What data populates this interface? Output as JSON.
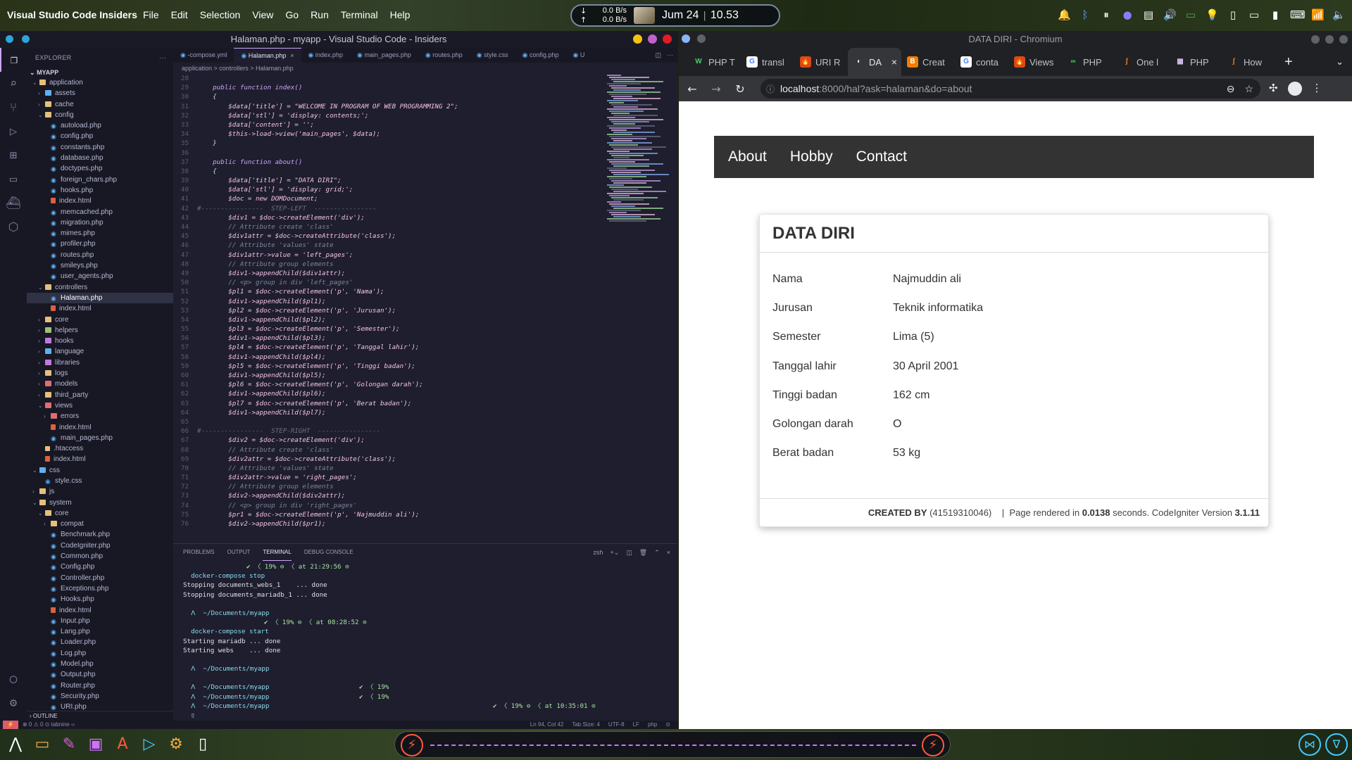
{
  "topbar": {
    "app_name": "Visual Studio Code Insiders",
    "menus": [
      "File",
      "Edit",
      "Selection",
      "View",
      "Go",
      "Run",
      "Terminal",
      "Help"
    ],
    "net_down": "0.0 B/s",
    "net_up": "0.0 B/s",
    "date": "Jum 24",
    "time": "10.53",
    "tray_icons": [
      "notification-icon",
      "bluetooth-icon",
      "pause-icon",
      "user-icon",
      "clipboard-icon",
      "volume-icon",
      "battery-icon",
      "bulb-icon",
      "monitor-icon",
      "phone-icon",
      "keyboard-icon",
      "wifi-icon",
      "speaker-icon"
    ]
  },
  "vscode": {
    "title": "Halaman.php - myapp - Visual Studio Code - Insiders",
    "explorer_label": "EXPLORER",
    "project": "MYAPP",
    "tree": [
      {
        "label": "application",
        "depth": 1,
        "type": "folder",
        "open": true
      },
      {
        "label": "assets",
        "depth": 2,
        "type": "folder",
        "open": false
      },
      {
        "label": "cache",
        "depth": 2,
        "type": "folder",
        "open": false
      },
      {
        "label": "config",
        "depth": 2,
        "type": "folder",
        "open": true
      },
      {
        "label": "autoload.php",
        "depth": 3,
        "type": "php"
      },
      {
        "label": "config.php",
        "depth": 3,
        "type": "php"
      },
      {
        "label": "constants.php",
        "depth": 3,
        "type": "php"
      },
      {
        "label": "database.php",
        "depth": 3,
        "type": "php"
      },
      {
        "label": "doctypes.php",
        "depth": 3,
        "type": "php"
      },
      {
        "label": "foreign_chars.php",
        "depth": 3,
        "type": "php"
      },
      {
        "label": "hooks.php",
        "depth": 3,
        "type": "php"
      },
      {
        "label": "index.html",
        "depth": 3,
        "type": "html"
      },
      {
        "label": "memcached.php",
        "depth": 3,
        "type": "php"
      },
      {
        "label": "migration.php",
        "depth": 3,
        "type": "php"
      },
      {
        "label": "mimes.php",
        "depth": 3,
        "type": "php"
      },
      {
        "label": "profiler.php",
        "depth": 3,
        "type": "php"
      },
      {
        "label": "routes.php",
        "depth": 3,
        "type": "php"
      },
      {
        "label": "smileys.php",
        "depth": 3,
        "type": "php"
      },
      {
        "label": "user_agents.php",
        "depth": 3,
        "type": "php"
      },
      {
        "label": "controllers",
        "depth": 2,
        "type": "folder",
        "open": true
      },
      {
        "label": "Halaman.php",
        "depth": 3,
        "type": "php",
        "selected": true
      },
      {
        "label": "index.html",
        "depth": 3,
        "type": "html"
      },
      {
        "label": "core",
        "depth": 2,
        "type": "folder",
        "open": false
      },
      {
        "label": "helpers",
        "depth": 2,
        "type": "folder",
        "open": false
      },
      {
        "label": "hooks",
        "depth": 2,
        "type": "folder",
        "open": false
      },
      {
        "label": "language",
        "depth": 2,
        "type": "folder",
        "open": false
      },
      {
        "label": "libraries",
        "depth": 2,
        "type": "folder",
        "open": false
      },
      {
        "label": "logs",
        "depth": 2,
        "type": "folder",
        "open": false
      },
      {
        "label": "models",
        "depth": 2,
        "type": "folder",
        "open": false
      },
      {
        "label": "third_party",
        "depth": 2,
        "type": "folder",
        "open": false
      },
      {
        "label": "views",
        "depth": 2,
        "type": "folder",
        "open": true
      },
      {
        "label": "errors",
        "depth": 3,
        "type": "folder",
        "open": false
      },
      {
        "label": "index.html",
        "depth": 3,
        "type": "html"
      },
      {
        "label": "main_pages.php",
        "depth": 3,
        "type": "php"
      },
      {
        "label": ".htaccess",
        "depth": 2,
        "type": "dot"
      },
      {
        "label": "index.html",
        "depth": 2,
        "type": "html"
      },
      {
        "label": "css",
        "depth": 1,
        "type": "folder",
        "open": true
      },
      {
        "label": "style.css",
        "depth": 2,
        "type": "css"
      },
      {
        "label": "js",
        "depth": 1,
        "type": "folder",
        "open": false
      },
      {
        "label": "system",
        "depth": 1,
        "type": "folder",
        "open": true
      },
      {
        "label": "core",
        "depth": 2,
        "type": "folder",
        "open": true
      },
      {
        "label": "compat",
        "depth": 3,
        "type": "folder",
        "open": false
      },
      {
        "label": "Benchmark.php",
        "depth": 3,
        "type": "php"
      },
      {
        "label": "CodeIgniter.php",
        "depth": 3,
        "type": "php"
      },
      {
        "label": "Common.php",
        "depth": 3,
        "type": "php"
      },
      {
        "label": "Config.php",
        "depth": 3,
        "type": "php"
      },
      {
        "label": "Controller.php",
        "depth": 3,
        "type": "php"
      },
      {
        "label": "Exceptions.php",
        "depth": 3,
        "type": "php"
      },
      {
        "label": "Hooks.php",
        "depth": 3,
        "type": "php"
      },
      {
        "label": "index.html",
        "depth": 3,
        "type": "html"
      },
      {
        "label": "Input.php",
        "depth": 3,
        "type": "php"
      },
      {
        "label": "Lang.php",
        "depth": 3,
        "type": "php"
      },
      {
        "label": "Loader.php",
        "depth": 3,
        "type": "php"
      },
      {
        "label": "Log.php",
        "depth": 3,
        "type": "php"
      },
      {
        "label": "Model.php",
        "depth": 3,
        "type": "php"
      },
      {
        "label": "Output.php",
        "depth": 3,
        "type": "php"
      },
      {
        "label": "Router.php",
        "depth": 3,
        "type": "php"
      },
      {
        "label": "Security.php",
        "depth": 3,
        "type": "php"
      },
      {
        "label": "URI.php",
        "depth": 3,
        "type": "php"
      }
    ],
    "outline_label": "OUTLINE",
    "tabs": [
      {
        "label": "-compose.yml",
        "active": false
      },
      {
        "label": "Halaman.php",
        "active": true
      },
      {
        "label": "index.php",
        "active": false
      },
      {
        "label": "main_pages.php",
        "active": false
      },
      {
        "label": "routes.php",
        "active": false
      },
      {
        "label": "style.css",
        "active": false
      },
      {
        "label": "config.php",
        "active": false
      },
      {
        "label": "U",
        "active": false
      }
    ],
    "breadcrumb": "application > controllers > Halaman.php",
    "code_lines": [
      {
        "n": "28",
        "t": ""
      },
      {
        "n": "29",
        "t": "    public function index()"
      },
      {
        "n": "30",
        "t": "    {"
      },
      {
        "n": "31",
        "t": "        $data['title'] = \"WELCOME IN PROGRAM OF WEB PROGRAMMING 2\";"
      },
      {
        "n": "32",
        "t": "        $data['stl'] = 'display: contents;';"
      },
      {
        "n": "33",
        "t": "        $data['content'] = '';"
      },
      {
        "n": "34",
        "t": "        $this->load->view('main_pages', $data);"
      },
      {
        "n": "35",
        "t": "    }"
      },
      {
        "n": "36",
        "t": ""
      },
      {
        "n": "37",
        "t": "    public function about()"
      },
      {
        "n": "38",
        "t": "    {"
      },
      {
        "n": "39",
        "t": "        $data['title'] = \"DATA DIRI\";"
      },
      {
        "n": "40",
        "t": "        $data['stl'] = 'display: grid;';"
      },
      {
        "n": "41",
        "t": "        $doc = new DOMDocument;"
      },
      {
        "n": "42",
        "t": "#----------------  STEP-LEFT  ----------------"
      },
      {
        "n": "43",
        "t": "        $div1 = $doc->createElement('div');"
      },
      {
        "n": "44",
        "t": "        // Attribute create 'class'"
      },
      {
        "n": "45",
        "t": "        $div1attr = $doc->createAttribute('class');"
      },
      {
        "n": "46",
        "t": "        // Attribute 'values' state"
      },
      {
        "n": "47",
        "t": "        $div1attr->value = 'left_pages';"
      },
      {
        "n": "48",
        "t": "        // Attribute group elements"
      },
      {
        "n": "49",
        "t": "        $div1->appendChild($div1attr);"
      },
      {
        "n": "50",
        "t": "        // <p> group in div 'left_pages'"
      },
      {
        "n": "51",
        "t": "        $pl1 = $doc->createElement('p', 'Nama');"
      },
      {
        "n": "52",
        "t": "        $div1->appendChild($pl1);"
      },
      {
        "n": "53",
        "t": "        $pl2 = $doc->createElement('p', 'Jurusan');"
      },
      {
        "n": "54",
        "t": "        $div1->appendChild($pl2);"
      },
      {
        "n": "55",
        "t": "        $pl3 = $doc->createElement('p', 'Semester');"
      },
      {
        "n": "56",
        "t": "        $div1->appendChild($pl3);"
      },
      {
        "n": "57",
        "t": "        $pl4 = $doc->createElement('p', 'Tanggal lahir');"
      },
      {
        "n": "58",
        "t": "        $div1->appendChild($pl4);"
      },
      {
        "n": "59",
        "t": "        $pl5 = $doc->createElement('p', 'Tinggi badan');"
      },
      {
        "n": "60",
        "t": "        $div1->appendChild($pl5);"
      },
      {
        "n": "61",
        "t": "        $pl6 = $doc->createElement('p', 'Golongan darah');"
      },
      {
        "n": "62",
        "t": "        $div1->appendChild($pl6);"
      },
      {
        "n": "63",
        "t": "        $pl7 = $doc->createElement('p', 'Berat badan');"
      },
      {
        "n": "64",
        "t": "        $div1->appendChild($pl7);"
      },
      {
        "n": "65",
        "t": ""
      },
      {
        "n": "66",
        "t": "#----------------  STEP-RIGHT  ----------------"
      },
      {
        "n": "67",
        "t": "        $div2 = $doc->createElement('div');"
      },
      {
        "n": "68",
        "t": "        // Attribute create 'class'"
      },
      {
        "n": "69",
        "t": "        $div2attr = $doc->createAttribute('class');"
      },
      {
        "n": "70",
        "t": "        // Attribute 'values' state"
      },
      {
        "n": "71",
        "t": "        $div2attr->value = 'right_pages';"
      },
      {
        "n": "72",
        "t": "        // Attribute group elements"
      },
      {
        "n": "73",
        "t": "        $div2->appendChild($div2attr);"
      },
      {
        "n": "74",
        "t": "        // <p> group in div 'right_pages'"
      },
      {
        "n": "75",
        "t": "        $pr1 = $doc->createElement('p', 'Najmuddin ali');"
      },
      {
        "n": "76",
        "t": "        $div2->appendChild($pr1);"
      }
    ],
    "panel_tabs": [
      {
        "label": "PROBLEMS",
        "active": false
      },
      {
        "label": "OUTPUT",
        "active": false
      },
      {
        "label": "TERMINAL",
        "active": true
      },
      {
        "label": "DEBUG CONSOLE",
        "active": false
      }
    ],
    "terminal_shell": "zsh",
    "terminal": [
      {
        "text": "",
        "right": "✔ 〈 19% ⊖ 〈 at 21:29:56 ⊙",
        "rightpos": "s1"
      },
      {
        "text": "  docker-compose stop",
        "cls": "c"
      },
      {
        "text": "Stopping documents_webs_1    ... done"
      },
      {
        "text": "Stopping documents_mariadb_1 ... done"
      },
      {
        "text": ""
      },
      {
        "text": "  ᐱ  ~/Documents/myapp",
        "cls": "c"
      },
      {
        "text": "",
        "right": "✔ 〈 19% ⊖ 〈 at 08:28:52 ⊙",
        "rightpos": "s2"
      },
      {
        "text": "  docker-compose start",
        "cls": "c"
      },
      {
        "text": "Starting mariadb ... done"
      },
      {
        "text": "Starting webs    ... done"
      },
      {
        "text": ""
      },
      {
        "text": "  ᐱ  ~/Documents/myapp",
        "cls": "c"
      },
      {
        "text": ""
      },
      {
        "text": "  ᐱ  ~/Documents/myapp",
        "cls": "c",
        "right": "✔ 〈 19%",
        "rightpos": "s3"
      },
      {
        "text": "  ᐱ  ~/Documents/myapp",
        "cls": "c",
        "right": "✔ 〈 19%",
        "rightpos": "s3"
      },
      {
        "text": "  ᐱ  ~/Documents/myapp",
        "cls": "c",
        "right": "✔ 〈 19% ⊖ 〈 at 10:35:01 ⊙",
        "rightpos": "s4"
      },
      {
        "text": "  ▯",
        "cls": "c"
      }
    ],
    "status_left": "⊗ 0 ⚠ 0     ⊙ tabnine ‹›",
    "status_right": [
      "Ln 94, Col 42",
      "Tab Size: 4",
      "UTF-8",
      "LF",
      "php",
      "⊙"
    ]
  },
  "chrome": {
    "title": "DATA DIRI - Chromium",
    "tabs": [
      {
        "label": "PHP T",
        "fav": "W",
        "color": "#202124",
        "fg": "#45d26a"
      },
      {
        "label": "transl",
        "fav": "G",
        "color": "#ffffff",
        "fg": "#4285f4"
      },
      {
        "label": "URI R",
        "fav": "🔥",
        "color": "#dd4814",
        "fg": "#fff"
      },
      {
        "label": "DA",
        "fav": "◐",
        "color": "#35363a",
        "fg": "#e8eaed",
        "active": true
      },
      {
        "label": "Creat",
        "fav": "B",
        "color": "#f57d00",
        "fg": "#fff"
      },
      {
        "label": "conta",
        "fav": "G",
        "color": "#ffffff",
        "fg": "#4285f4"
      },
      {
        "label": "Views",
        "fav": "🔥",
        "color": "#dd4814",
        "fg": "#fff"
      },
      {
        "label": "PHP",
        "fav": "∞",
        "color": "#202124",
        "fg": "#45d26a"
      },
      {
        "label": "One l",
        "fav": "ʃ",
        "color": "#202124",
        "fg": "#f48024"
      },
      {
        "label": "PHP",
        "fav": "▦",
        "color": "#202124",
        "fg": "#d5c5f5"
      },
      {
        "label": "How",
        "fav": "ʃ",
        "color": "#202124",
        "fg": "#f48024"
      }
    ],
    "url_host": "localhost",
    "url_path": ":8000/hal?ask=halaman&do=about",
    "page": {
      "nav": [
        "About",
        "Hobby",
        "Contact"
      ],
      "card_title": "DATA DIRI",
      "rows": [
        {
          "k": "Nama",
          "v": "Najmuddin ali"
        },
        {
          "k": "Jurusan",
          "v": "Teknik informatika"
        },
        {
          "k": "Semester",
          "v": "Lima (5)"
        },
        {
          "k": "Tanggal lahir",
          "v": "30 April 2001"
        },
        {
          "k": "Tinggi badan",
          "v": "162 cm"
        },
        {
          "k": "Golongan darah",
          "v": "O"
        },
        {
          "k": "Berat badan",
          "v": "53 kg"
        }
      ],
      "footer_created_by": "CREATED BY",
      "footer_id": "(41519310046)",
      "footer_rendered": "Page rendered in",
      "footer_seconds_value": "0.0138",
      "footer_seconds": "seconds. CodeIgniter Version",
      "footer_version": "3.1.11"
    }
  },
  "colors": {
    "vscode_bg": "#1e1e2e",
    "sidebar_bg": "#181825",
    "navbar_bg": "#333333",
    "chrome_dark": "#202124",
    "accent": "#cba6f7"
  }
}
